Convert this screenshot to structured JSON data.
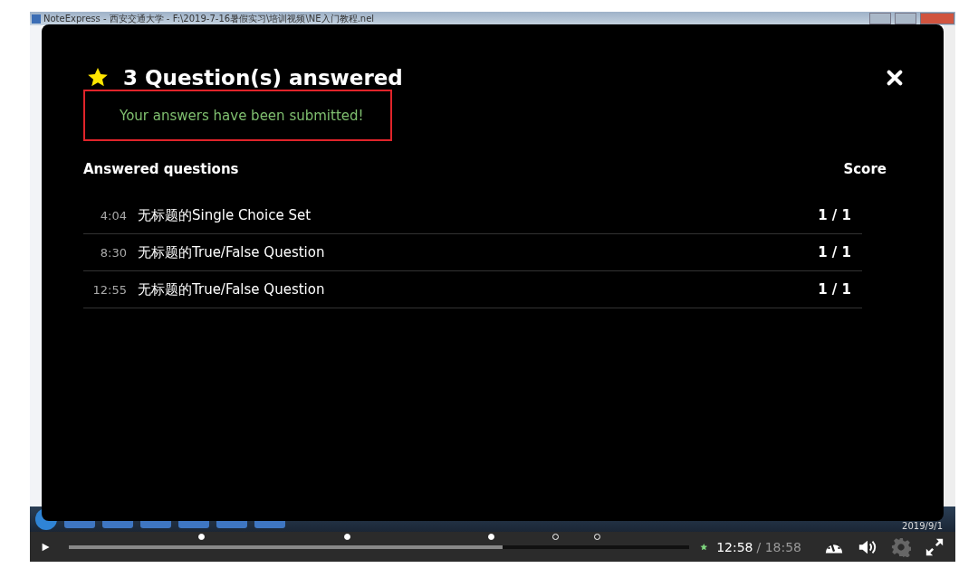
{
  "background_window": {
    "title": "NoteExpress - 西安交通大学 - F:\\2019-7-16暑假实习\\培训视频\\NE入门教程.nel",
    "taskbar_date": "2019/9/1"
  },
  "summary": {
    "title": "3 Question(s) answered",
    "message": "Your answers have been submitted!",
    "column_question": "Answered questions",
    "column_score": "Score",
    "rows": [
      {
        "time": "4:04",
        "question": "无标题的Single Choice Set",
        "score": "1 / 1"
      },
      {
        "time": "8:30",
        "question": "无标题的True/False Question",
        "score": "1 / 1"
      },
      {
        "time": "12:55",
        "question": "无标题的True/False Question",
        "score": "1 / 1"
      }
    ]
  },
  "player": {
    "level": 0.7,
    "current_time": "12:58",
    "duration": "/ 18:58",
    "settings_disabled": true,
    "markers": [
      {
        "level": 0.214,
        "answered": true
      },
      {
        "level": 0.448,
        "answered": true
      },
      {
        "level": 0.681,
        "answered": true
      },
      {
        "level": 0.784,
        "answered": false
      },
      {
        "level": 0.851,
        "answered": false
      }
    ]
  }
}
